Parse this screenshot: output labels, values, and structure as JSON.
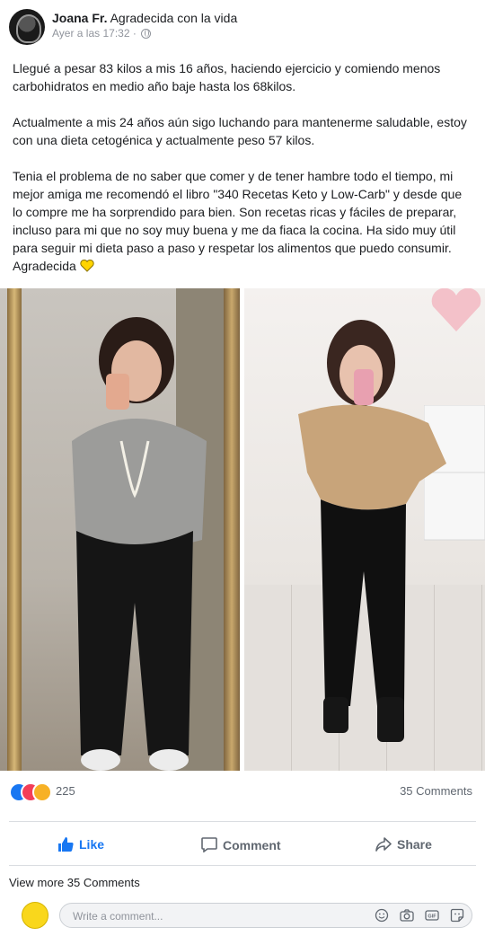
{
  "post": {
    "author": "Joana Fr.",
    "feeling": "Agradecida con la vida",
    "time": "Ayer a las 17:32",
    "privacy_sep": "·",
    "paragraphs": [
      "Llegué a pesar 83 kilos a mis 16 años, haciendo ejercicio y comiendo menos carbohidratos en medio año baje hasta los 68kilos.",
      "Actualmente a mis 24 años aún sigo luchando para mantenerme saludable, estoy con una dieta cetogénica y actualmente peso 57 kilos.",
      "Tenia el problema de no saber que comer y de tener hambre todo el tiempo, mi mejor amiga me recomendó el libro \"340 Recetas Keto y Low-Carb\" y desde que lo compre me ha sorprendido para bien. Son recetas ricas y fáciles de preparar, incluso para mi que no soy muy buena y me da fiaca la cocina. Ha sido muy útil para seguir mi dieta paso a paso y respetar los alimentos que puedo consumir."
    ],
    "closing": "Agradecida",
    "closing_emoji": "yellow-heart-icon"
  },
  "reactions": {
    "types": [
      "like",
      "love",
      "wow"
    ],
    "count": "225",
    "comments": "35 Comments"
  },
  "actions": {
    "like": "Like",
    "comment": "Comment",
    "share": "Share"
  },
  "view_more": "View more 35 Comments",
  "composer": {
    "placeholder": "Write a comment..."
  },
  "colors": {
    "accent": "#1877f2",
    "love": "#f33e58",
    "wow": "#f7b125"
  }
}
